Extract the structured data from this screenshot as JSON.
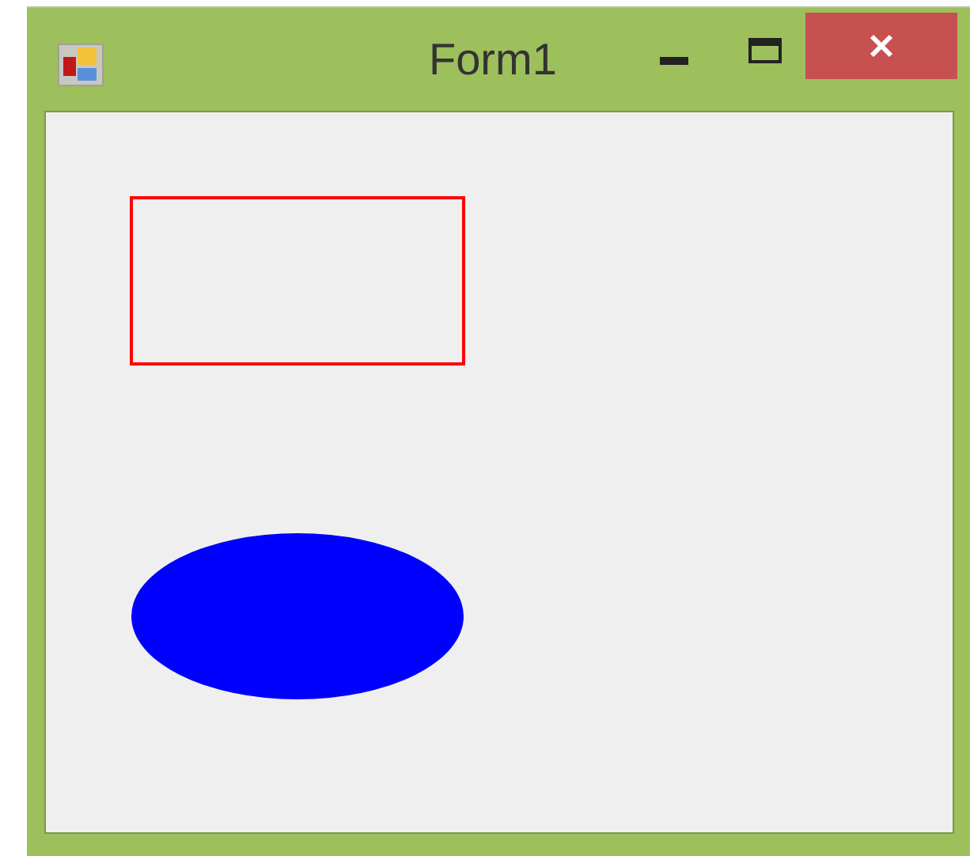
{
  "window": {
    "title": "Form1"
  },
  "shapes": [
    {
      "kind": "rectangle",
      "color": "#ff0000"
    },
    {
      "kind": "ellipse",
      "color": "#0000ff"
    }
  ]
}
